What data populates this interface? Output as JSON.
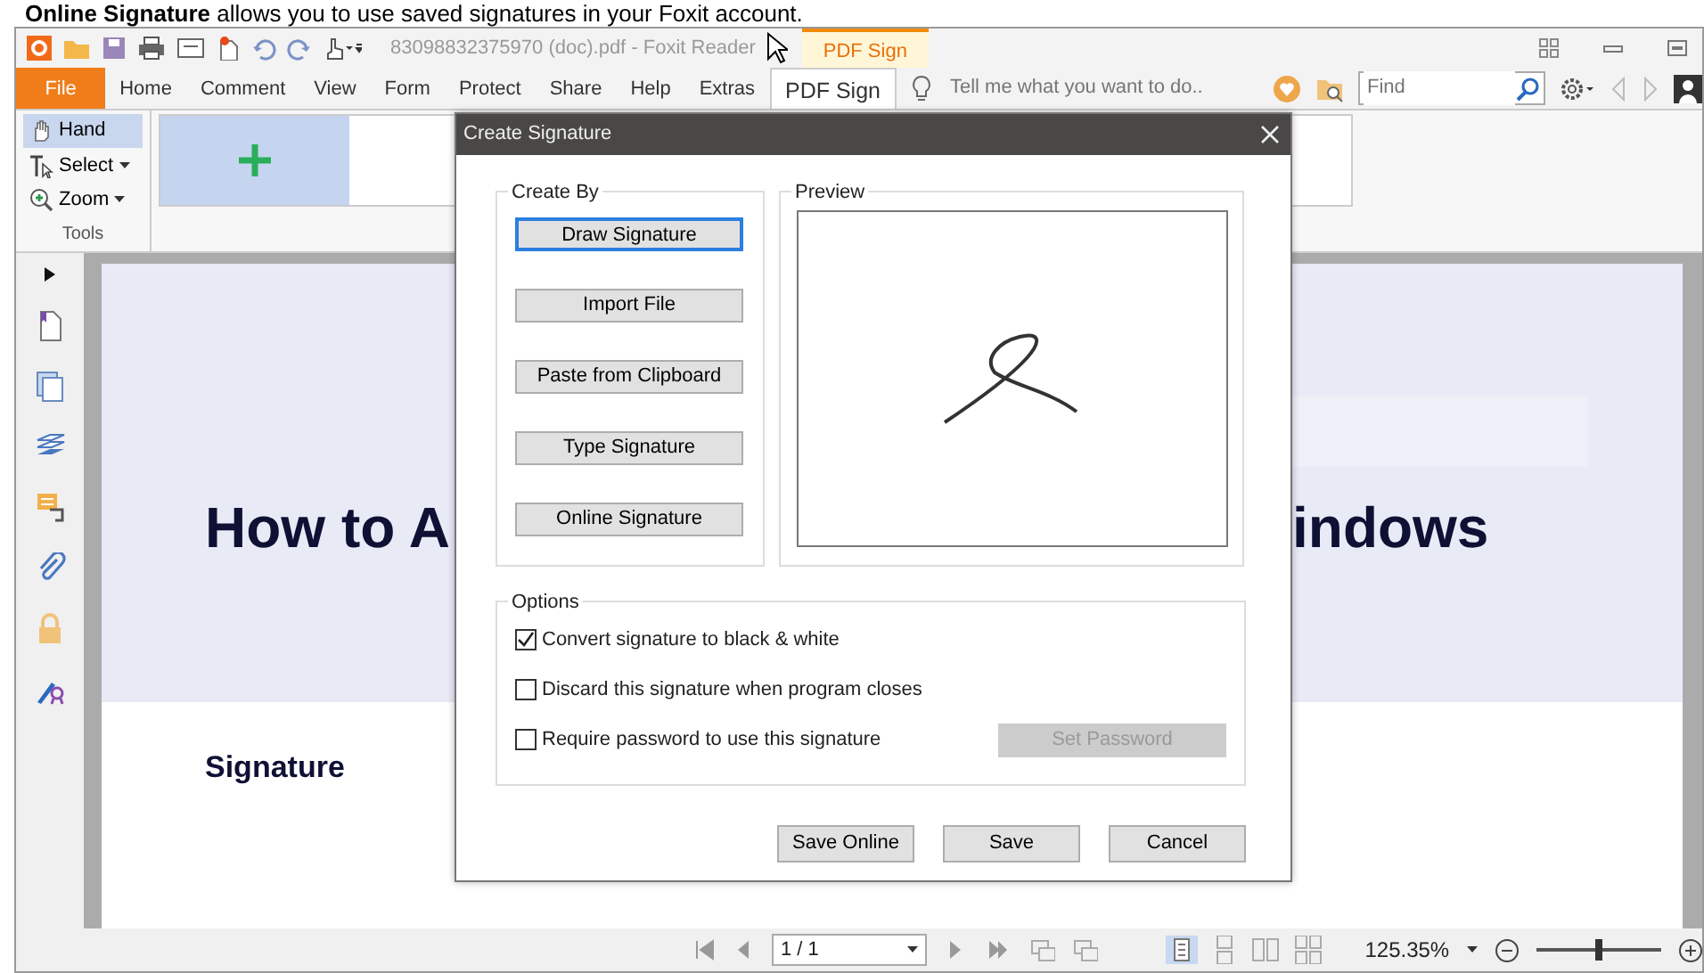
{
  "caption": "**Online Signature** allows you to use saved signatures in your Foxit account.",
  "window": {
    "title": "83098832375970 (doc).pdf - Foxit Reader",
    "context_tab": "PDF Sign"
  },
  "ribbon_tabs": [
    {
      "label": "File",
      "kind": "file",
      "selected": false
    },
    {
      "label": "Home",
      "kind": "tab",
      "selected": false
    },
    {
      "label": "Comment",
      "kind": "tab",
      "selected": false
    },
    {
      "label": "View",
      "kind": "tab",
      "selected": false
    },
    {
      "label": "Form",
      "kind": "tab",
      "selected": false
    },
    {
      "label": "Protect",
      "kind": "tab",
      "selected": false
    },
    {
      "label": "Share",
      "kind": "tab",
      "selected": false
    },
    {
      "label": "Help",
      "kind": "tab",
      "selected": false
    },
    {
      "label": "Extras",
      "kind": "tab",
      "selected": false
    },
    {
      "label": "PDF Sign",
      "kind": "tab",
      "selected": true
    }
  ],
  "tell_me": {
    "placeholder": "Tell me what you want to do.."
  },
  "find": {
    "placeholder": "Find"
  },
  "tools": {
    "items": [
      {
        "label": "Hand",
        "kind": "hand",
        "selected": true
      },
      {
        "label": "Select",
        "kind": "select",
        "selected": false
      },
      {
        "label": "Zoom",
        "kind": "zoom",
        "selected": false
      }
    ],
    "group_label": "Tools"
  },
  "signature_gallery": [
    {
      "kind": "add",
      "selected": true
    }
  ],
  "document": {
    "heading_left": "How to A",
    "heading_right": "indows",
    "subheading": "Signature"
  },
  "dialog": {
    "title": "Create Signature",
    "create_by_label": "Create By",
    "create_by_buttons": [
      {
        "label": "Draw Signature",
        "selected": true
      },
      {
        "label": "Import File",
        "selected": false
      },
      {
        "label": "Paste from Clipboard",
        "selected": false
      },
      {
        "label": "Type Signature",
        "selected": false
      },
      {
        "label": "Online Signature",
        "selected": false
      }
    ],
    "preview_label": "Preview",
    "options_label": "Options",
    "options": [
      {
        "label": "Convert signature to black & white",
        "checked": true
      },
      {
        "label": "Discard this signature when program closes",
        "checked": false
      },
      {
        "label": "Require password to use this signature",
        "checked": false
      }
    ],
    "set_password": {
      "label": "Set Password",
      "disabled": true
    },
    "buttons": [
      "Save Online",
      "Save",
      "Cancel"
    ]
  },
  "status_bar": {
    "page": "1 / 1",
    "zoom": "125.35%",
    "zoom_slider": {
      "level": 0.5
    }
  }
}
